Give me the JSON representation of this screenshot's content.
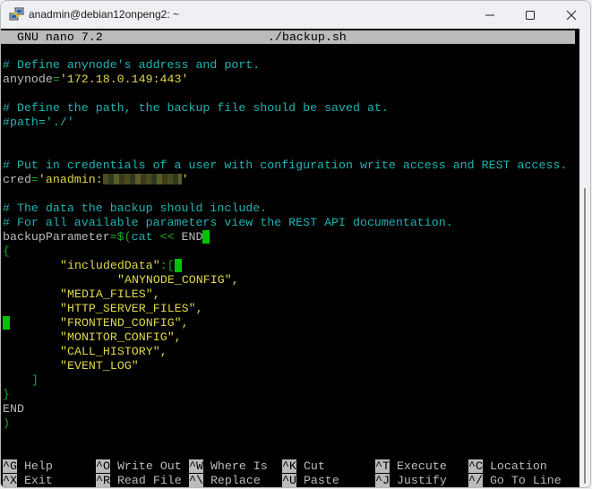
{
  "window": {
    "title": "anadmin@debian12onpeng2: ~",
    "controls": {
      "minimize": "—",
      "maximize": "☐",
      "close": "✕"
    }
  },
  "nano": {
    "version_label": "GNU nano 7.2",
    "filename": "./backup.sh"
  },
  "editor": {
    "comment1": "# Define anynode's address and port.",
    "anynode_var": "anynode",
    "anynode_eq": "=",
    "anynode_value": "'172.18.0.149:443'",
    "comment2": "# Define the path, the backup file should be saved at.",
    "path_line": "#path='./'",
    "comment3": "# Put in credentials of a user with configuration write access and REST access.",
    "cred_var": "cred",
    "cred_eq": "=",
    "cred_value_prefix": "'anadmin:",
    "cred_value_suffix": "'",
    "comment4": "# The data the backup should include.",
    "comment5": "# For all available parameters view the REST API documentation.",
    "backup_var": "backupParameter",
    "backup_eq": "=$(",
    "backup_cat": "cat",
    "backup_heredoc": " << ",
    "backup_end": "END",
    "open_brace": "{",
    "included_key": "\"includedData\"",
    "included_colon": ":[",
    "items": [
      "\"ANYNODE_CONFIG\",",
      "\"MEDIA_FILES\",",
      "\"HTTP_SERVER_FILES\",",
      "\"FRONTEND_CONFIG\",",
      "\"MONITOR_CONFIG\",",
      "\"CALL_HISTORY\",",
      "\"EVENT_LOG\""
    ],
    "close_bracket": "]",
    "close_brace": "}",
    "end_marker": "END",
    "close_paren": ")"
  },
  "shortcuts": [
    {
      "key": "^G",
      "label": "Help"
    },
    {
      "key": "^O",
      "label": "Write Out"
    },
    {
      "key": "^W",
      "label": "Where Is"
    },
    {
      "key": "^K",
      "label": "Cut"
    },
    {
      "key": "^T",
      "label": "Execute"
    },
    {
      "key": "^C",
      "label": "Location"
    },
    {
      "key": "^X",
      "label": "Exit"
    },
    {
      "key": "^R",
      "label": "Read File"
    },
    {
      "key": "^\\",
      "label": "Replace"
    },
    {
      "key": "^U",
      "label": "Paste"
    },
    {
      "key": "^J",
      "label": "Justify"
    },
    {
      "key": "^/",
      "label": "Go To Line"
    }
  ],
  "colors": {
    "comment": "#1fb3b3",
    "string": "#e0d84a",
    "bracket": "#1fa81f",
    "cursor": "#00c400",
    "header_bg": "#bbbbbb"
  }
}
